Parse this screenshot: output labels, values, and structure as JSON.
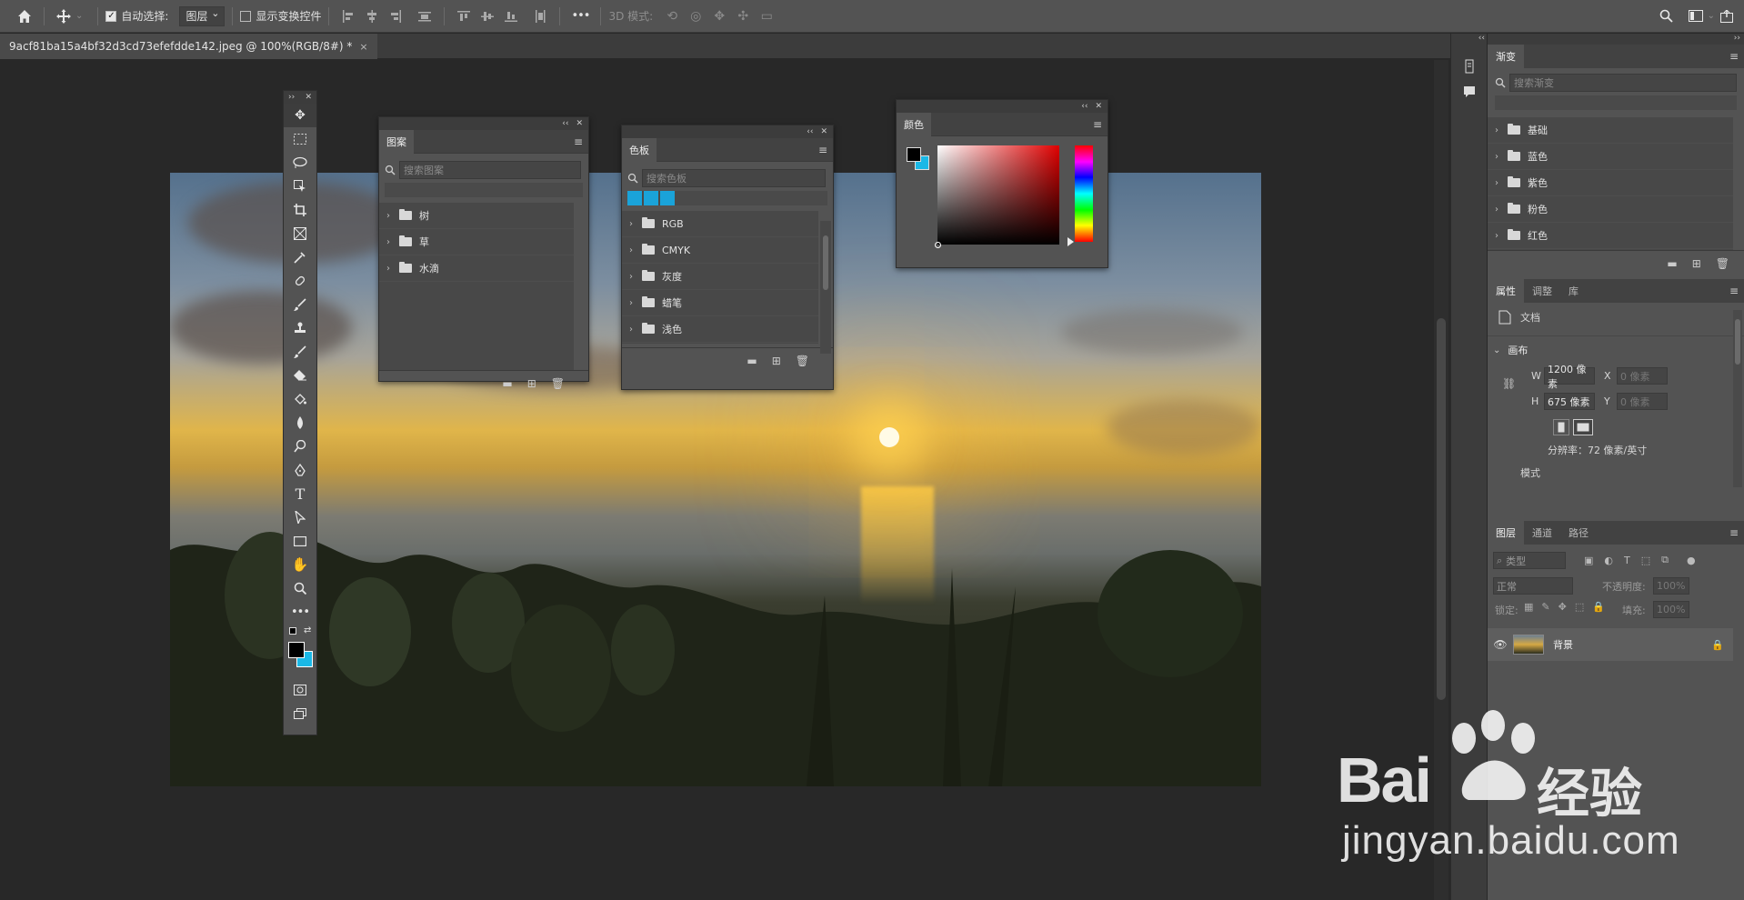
{
  "optbar": {
    "auto_select_label": "自动选择:",
    "auto_select_value": "图层",
    "show_transform_label": "显示变换控件",
    "mode_3d_label": "3D 模式:",
    "more_label": "•••"
  },
  "document": {
    "tab_title": "9acf81ba15a4bf32d3cd73efefdde142.jpeg @ 100%(RGB/8#) *",
    "close_label": "×"
  },
  "patterns_panel": {
    "title": "图案",
    "search_placeholder": "搜索图案",
    "folders": [
      "树",
      "草",
      "水滴"
    ]
  },
  "swatches_panel": {
    "title": "色板",
    "search_placeholder": "搜索色板",
    "recent_colors": [
      "#1aa3d9",
      "#1aa3d9",
      "#1aa3d9"
    ],
    "folders": [
      "RGB",
      "CMYK",
      "灰度",
      "蜡笔",
      "浅色"
    ]
  },
  "color_panel": {
    "title": "颜色",
    "foreground": "#000000",
    "background": "#1ab8e6",
    "hue": "#e00000"
  },
  "gradient_panel": {
    "title": "渐变",
    "search_placeholder": "搜索渐变",
    "folders": [
      "基础",
      "蓝色",
      "紫色",
      "粉色",
      "红色"
    ]
  },
  "properties_panel": {
    "tabs": [
      "属性",
      "调整",
      "库"
    ],
    "doc_label": "文档",
    "canvas_label": "画布",
    "w_label": "W",
    "w_value": "1200 像素",
    "h_label": "H",
    "h_value": "675 像素",
    "x_label": "X",
    "x_value": "0 像素",
    "y_label": "Y",
    "y_value": "0 像素",
    "resolution": "分辨率：72 像素/英寸",
    "mode_label": "模式"
  },
  "layers_panel": {
    "tabs": [
      "图层",
      "通道",
      "路径"
    ],
    "filter_kind": "类型",
    "blend_mode": "正常",
    "opacity_label": "不透明度:",
    "opacity_value": "100%",
    "lock_label": "锁定:",
    "fill_label": "填充:",
    "fill_value": "100%",
    "layers": [
      {
        "name": "背景",
        "visible": true,
        "locked": true
      }
    ]
  },
  "watermark": {
    "brand": "Bai",
    "brand2": "经验",
    "url": "jingyan.baidu.com"
  }
}
